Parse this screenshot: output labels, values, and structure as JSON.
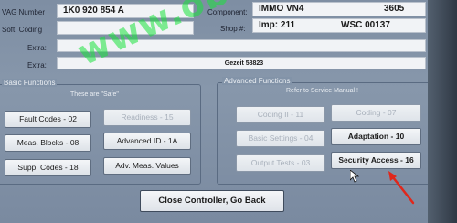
{
  "header": {
    "vag_number_label": "VAG Number",
    "vag_number_value": "1K0 920 854 A",
    "component_label": "Component:",
    "component_value": "IMMO VN4",
    "component_code": "3605",
    "soft_coding_label": "Soft. Coding",
    "shop_label": "Shop #:",
    "shop_value": "Imp: 211",
    "wsc_value": "WSC 00137",
    "extra1_label": "Extra:",
    "extra2_label": "Extra:",
    "extra2_value": "Gezeit 58823"
  },
  "basic": {
    "title": "Basic Functions",
    "note": "These are \"Safe\"",
    "buttons": [
      {
        "label": "Fault Codes - 02",
        "enabled": true
      },
      {
        "label": "Readiness - 15",
        "enabled": false
      },
      {
        "label": "Meas. Blocks - 08",
        "enabled": true
      },
      {
        "label": "Advanced ID - 1A",
        "enabled": true
      },
      {
        "label": "Supp. Codes - 18",
        "enabled": true
      },
      {
        "label": "Adv. Meas. Values",
        "enabled": true
      }
    ]
  },
  "advanced": {
    "title": "Advanced Functions",
    "note": "Refer to Service Manual !",
    "buttons": [
      {
        "label": "Coding II - 11",
        "enabled": false
      },
      {
        "label": "Coding - 07",
        "enabled": false
      },
      {
        "label": "Basic Settings - 04",
        "enabled": false
      },
      {
        "label": "Adaptation - 10",
        "enabled": true
      },
      {
        "label": "Output Tests - 03",
        "enabled": false
      },
      {
        "label": "Security Access - 16",
        "enabled": true
      }
    ]
  },
  "footer": {
    "close_label": "Close Controller, Go Back"
  },
  "watermark": "www.obd-auto-repair.com",
  "colors": {
    "watermark": "#19e13c",
    "arrow": "#e0271b"
  }
}
